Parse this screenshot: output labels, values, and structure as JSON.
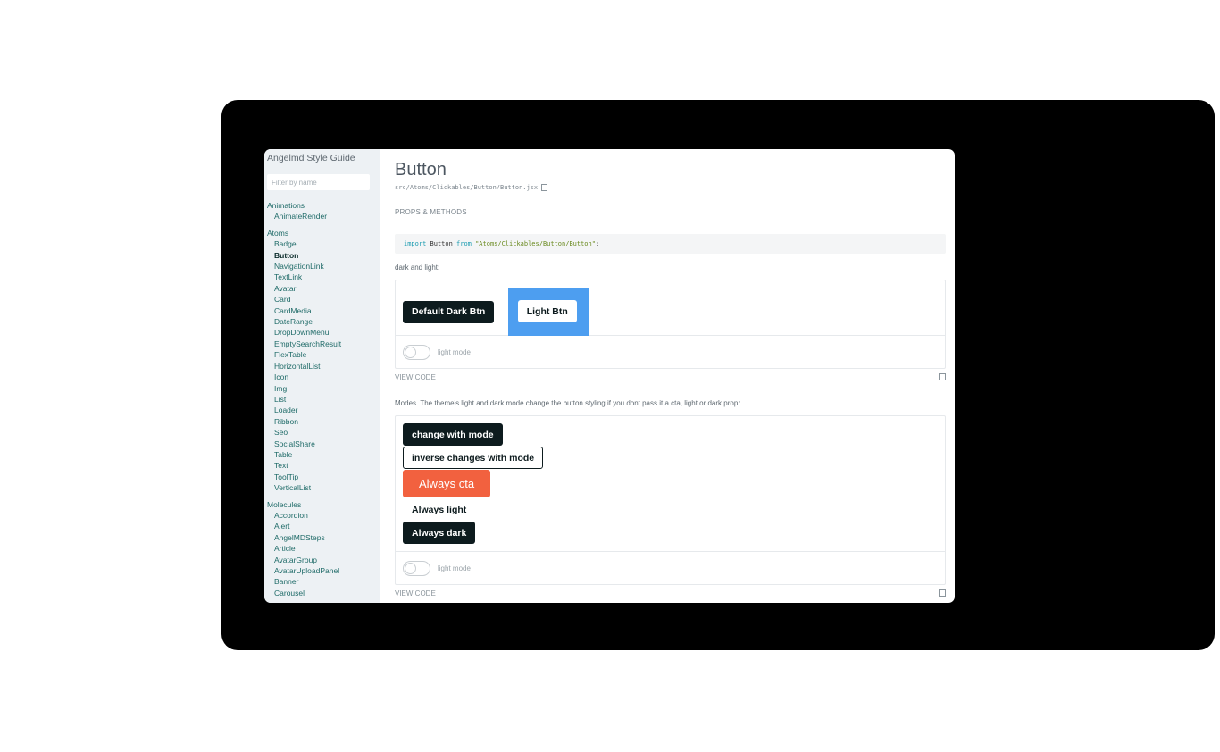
{
  "sidebar": {
    "app_title": "Angelmd Style Guide",
    "filter_placeholder": "Filter by name",
    "groups": [
      {
        "title": "Animations",
        "items": [
          "AnimateRender"
        ]
      },
      {
        "title": "Atoms",
        "items": [
          "Badge",
          "Button",
          "NavigationLink",
          "TextLink",
          "Avatar",
          "Card",
          "CardMedia",
          "DateRange",
          "DropDownMenu",
          "EmptySearchResult",
          "FlexTable",
          "HorizontalList",
          "Icon",
          "Img",
          "List",
          "Loader",
          "Ribbon",
          "Seo",
          "SocialShare",
          "Table",
          "Text",
          "ToolTip",
          "VerticalList"
        ]
      },
      {
        "title": "Molecules",
        "items": [
          "Accordion",
          "Alert",
          "AngelMDSteps",
          "Article",
          "AvatarGroup",
          "AvatarUploadPanel",
          "Banner",
          "Carousel"
        ]
      }
    ],
    "active_item": "Button"
  },
  "main": {
    "title": "Button",
    "path": "src/Atoms/Clickables/Button/Button.jsx",
    "props_label": "PROPS & METHODS",
    "code": {
      "keyword_import": "import",
      "name": " Button ",
      "keyword_from": "from",
      "module": " \"Atoms/Clickables/Button/Button\"",
      "end": ";"
    },
    "example1": {
      "description": "dark and light:",
      "dark_button": "Default Dark Btn",
      "light_button": "Light Btn",
      "toggle_label": "light mode",
      "view_code": "VIEW CODE"
    },
    "example2": {
      "description": "Modes. The theme's light and dark mode change the button styling if you dont pass it a cta, light or dark prop:",
      "buttons": {
        "change": "change with mode",
        "inverse": "inverse changes with mode",
        "cta": "Always cta",
        "light": "Always light",
        "dark": "Always dark"
      },
      "toggle_label": "light mode",
      "view_code": "VIEW CODE"
    }
  },
  "colors": {
    "cta": "#f2613f",
    "dark": "#0d1b1e",
    "light_bg": "#4d9ef0",
    "sidebar_bg": "#edf1f4",
    "link": "#1f6b68"
  }
}
